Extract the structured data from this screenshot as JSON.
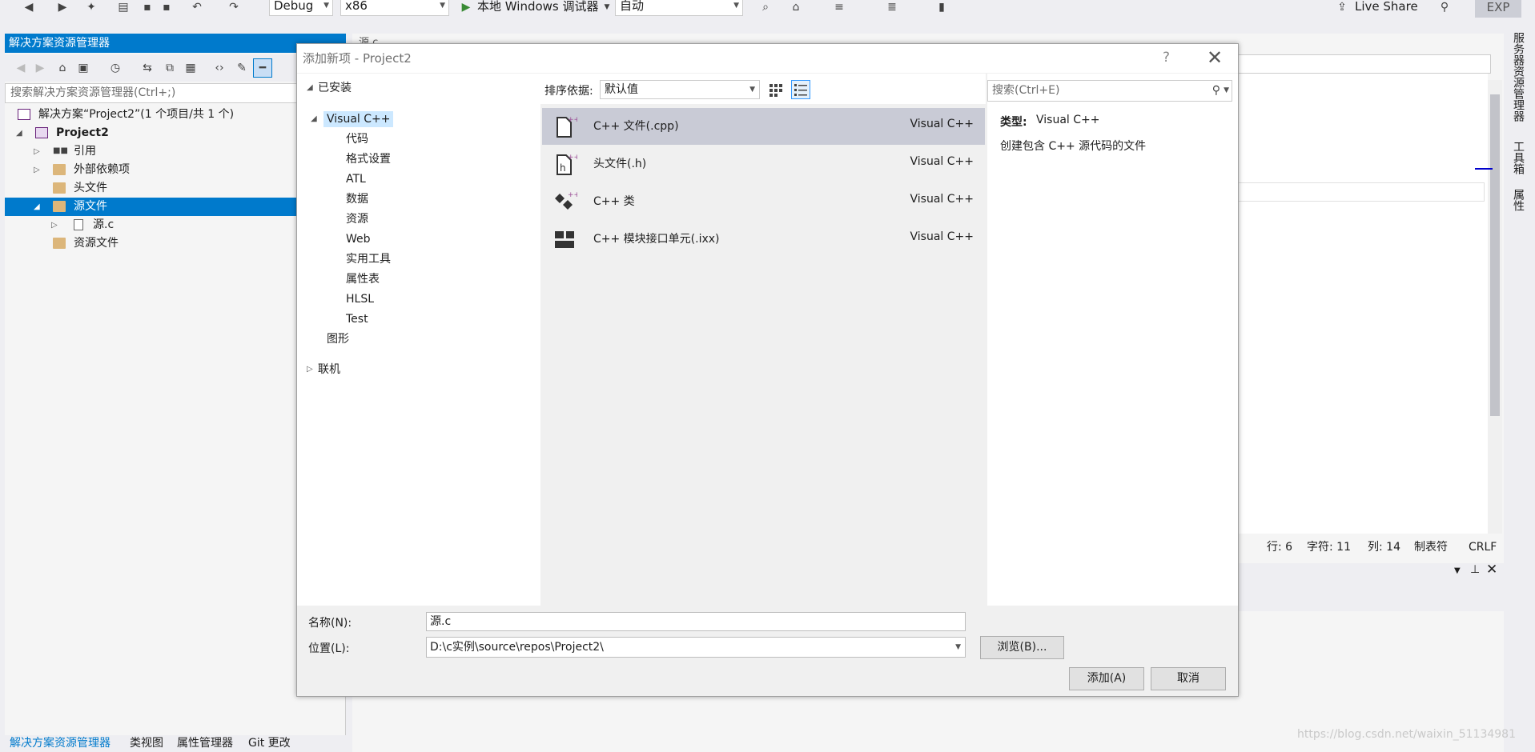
{
  "toolbar": {
    "config": "Debug",
    "platform": "x86",
    "run_label": "本地 Windows 调试器",
    "mode": "自动",
    "live_share": "Live Share",
    "exp": "EXP"
  },
  "solution_explorer": {
    "title": "解决方案资源管理器",
    "search_placeholder": "搜索解决方案资源管理器(Ctrl+;)",
    "tree": {
      "solution": "解决方案“Project2”(1 个项目/共 1 个)",
      "project": "Project2",
      "references": "引用",
      "external_deps": "外部依赖项",
      "headers": "头文件",
      "sources": "源文件",
      "source_file": "源.c",
      "resources": "资源文件"
    },
    "bottom_tabs": [
      "解决方案资源管理器",
      "类视图",
      "属性管理器",
      "Git 更改"
    ]
  },
  "editor": {
    "tab": "源.c",
    "status": {
      "line": "行: 6",
      "char": "字符: 11",
      "col": "列: 14",
      "tabs": "制表符",
      "eol": "CRLF"
    }
  },
  "side_tabs": [
    "服务器资源管理器",
    "工具箱",
    "属性"
  ],
  "watermark": "https://blog.csdn.net/waixin_51134981",
  "dialog": {
    "title": "添加新项 - Project2",
    "help": "?",
    "installed": "已安装",
    "visual_cpp": "Visual C++",
    "categories": [
      "代码",
      "格式设置",
      "ATL",
      "数据",
      "资源",
      "Web",
      "实用工具",
      "属性表",
      "HLSL",
      "Test"
    ],
    "graphics": "图形",
    "online": "联机",
    "sort_label": "排序依据:",
    "sort_value": "默认值",
    "search_placeholder": "搜索(Ctrl+E)",
    "templates": [
      {
        "name": "C++ 文件(.cpp)",
        "lang": "Visual C++"
      },
      {
        "name": "头文件(.h)",
        "lang": "Visual C++"
      },
      {
        "name": "C++ 类",
        "lang": "Visual C++"
      },
      {
        "name": "C++ 模块接口单元(.ixx)",
        "lang": "Visual C++"
      }
    ],
    "info": {
      "type_key": "类型:",
      "type_value": "Visual C++",
      "description": "创建包含 C++ 源代码的文件"
    },
    "name_label": "名称(N):",
    "name_value": "源.c",
    "location_label": "位置(L):",
    "location_value": "D:\\c实例\\source\\repos\\Project2\\",
    "browse": "浏览(B)...",
    "add": "添加(A)",
    "cancel": "取消"
  },
  "colors": {
    "accent": "#007acc",
    "selection": "#c9cbd6",
    "tree_selection": "#cce8ff"
  }
}
